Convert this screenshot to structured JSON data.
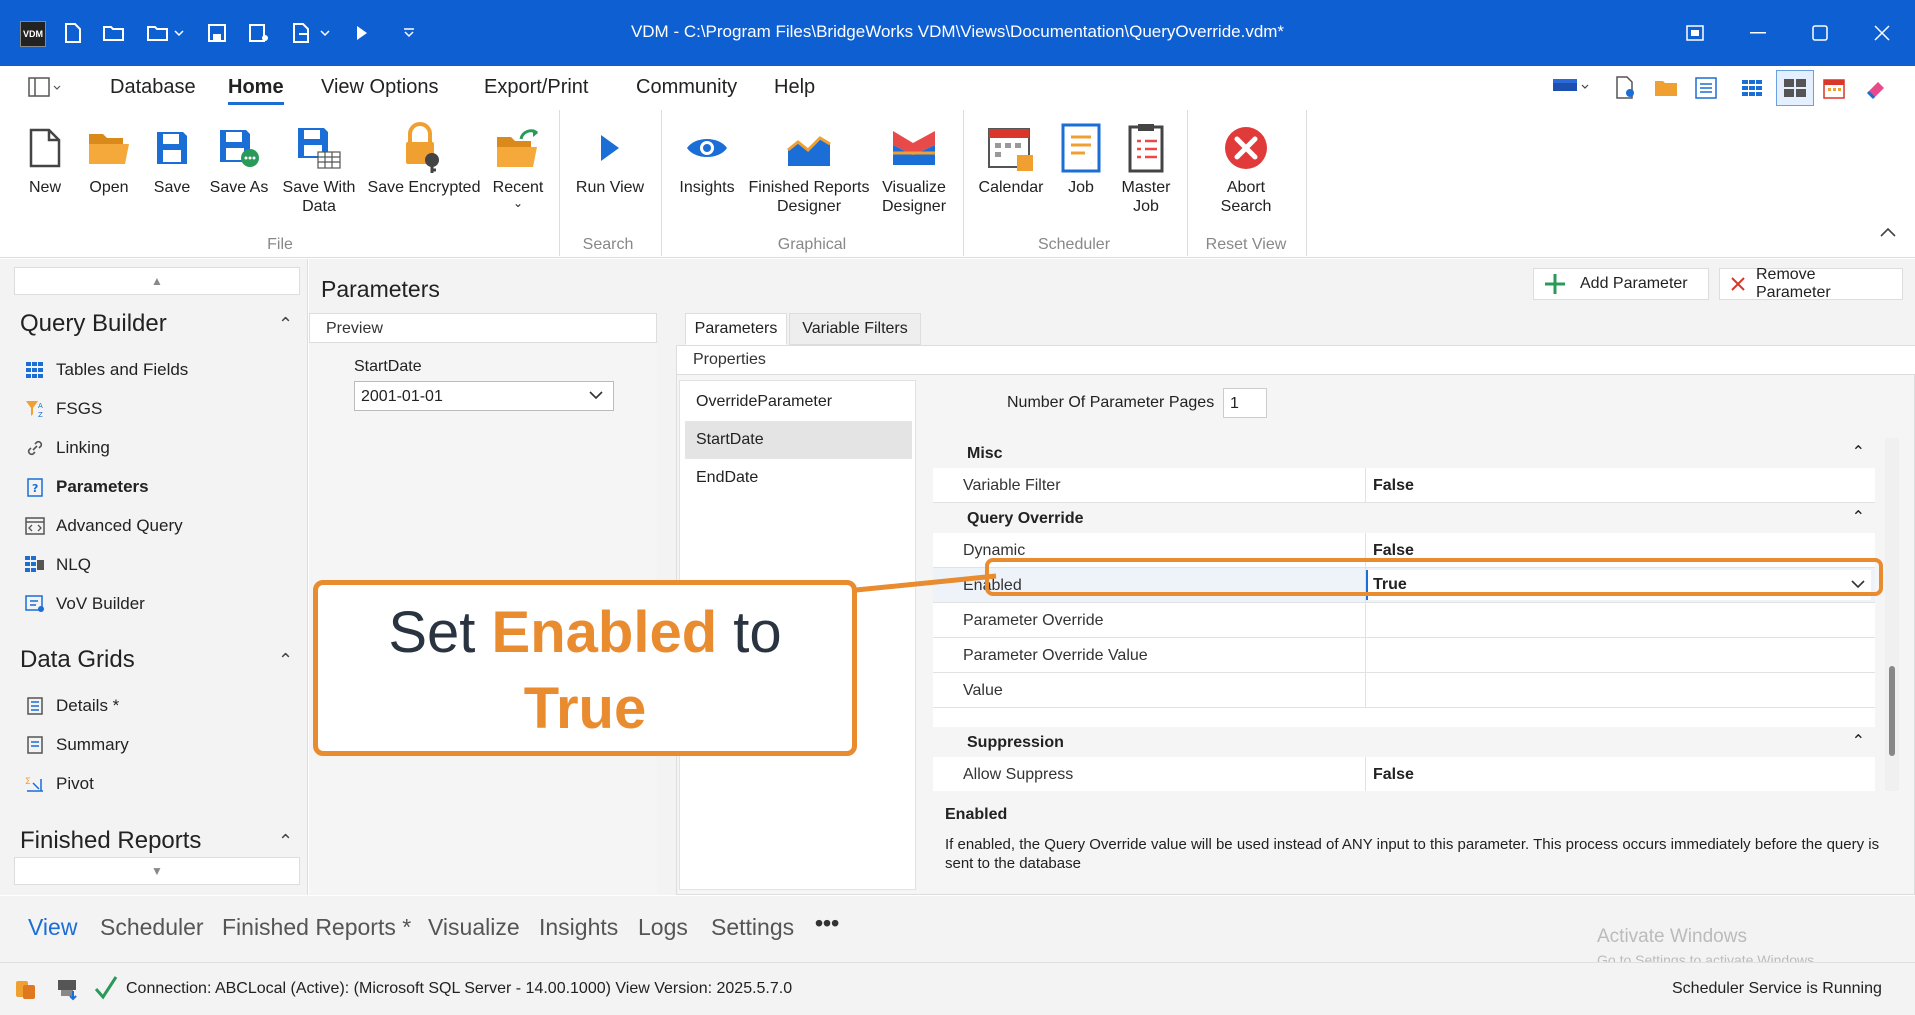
{
  "window": {
    "title": "VDM - C:\\Program Files\\BridgeWorks VDM\\Views\\Documentation\\QueryOverride.vdm*",
    "app_badge": "VDM"
  },
  "menu": {
    "items": [
      "Database",
      "Home",
      "View Options",
      "Export/Print",
      "Community",
      "Help"
    ],
    "active": "Home"
  },
  "ribbon": {
    "file": {
      "group_label": "File",
      "new": "New",
      "open": "Open",
      "save": "Save",
      "save_as": "Save As",
      "save_with_data_l1": "Save With",
      "save_with_data_l2": "Data",
      "save_encrypted": "Save Encrypted",
      "recent": "Recent"
    },
    "search": {
      "group_label": "Search",
      "run_view": "Run View"
    },
    "graphical": {
      "group_label": "Graphical",
      "insights": "Insights",
      "finished_reports_l1": "Finished Reports",
      "finished_reports_l2": "Designer",
      "visualize_l1": "Visualize",
      "visualize_l2": "Designer"
    },
    "scheduler": {
      "group_label": "Scheduler",
      "calendar": "Calendar",
      "job": "Job",
      "master_job_l1": "Master",
      "master_job_l2": "Job"
    },
    "reset_view": {
      "group_label": "Reset View",
      "abort_l1": "Abort",
      "abort_l2": "Search"
    }
  },
  "sidebar": {
    "query_builder": {
      "title": "Query Builder",
      "items": [
        "Tables and Fields",
        "FSGS",
        "Linking",
        "Parameters",
        "Advanced Query",
        "NLQ",
        "VoV Builder"
      ]
    },
    "data_grids": {
      "title": "Data Grids",
      "items": [
        "Details *",
        "Summary",
        "Pivot"
      ]
    },
    "finished_reports": {
      "title": "Finished Reports"
    }
  },
  "parameters": {
    "title": "Parameters",
    "add_button": "Add Parameter",
    "remove_button": "Remove Parameter",
    "preview": {
      "header": "Preview",
      "field_label": "StartDate",
      "field_value": "2001-01-01"
    },
    "tabs": [
      "Parameters",
      "Variable Filters"
    ],
    "properties_header": "Properties",
    "param_list": [
      "OverrideParameter",
      "StartDate",
      "EndDate"
    ],
    "selected_param": "StartDate",
    "num_pages_label": "Number Of Parameter Pages",
    "num_pages_value": "1",
    "grid": {
      "misc": "Misc",
      "variable_filter": {
        "name": "Variable Filter",
        "value": "False"
      },
      "query_override": "Query Override",
      "dynamic": {
        "name": "Dynamic",
        "value": "False"
      },
      "enabled": {
        "name": "Enabled",
        "value": "True"
      },
      "parameter_override": {
        "name": "Parameter Override",
        "value": ""
      },
      "parameter_override_value": {
        "name": "Parameter Override Value",
        "value": ""
      },
      "value": {
        "name": "Value",
        "value": ""
      },
      "suppression": "Suppression",
      "allow_suppress": {
        "name": "Allow Suppress",
        "value": "False"
      }
    },
    "description": {
      "title": "Enabled",
      "text": "If enabled, the Query Override value will be used instead of ANY input to this parameter. This process occurs immediately before the query is sent to the database"
    }
  },
  "callout": {
    "set": "Set",
    "enabled": "Enabled",
    "to": "to",
    "true": "True"
  },
  "bottom_tabs": [
    "View",
    "Scheduler",
    "Finished Reports *",
    "Visualize",
    "Insights",
    "Logs",
    "Settings",
    "•••"
  ],
  "status": {
    "connection": "Connection: ABCLocal (Active): (Microsoft SQL Server - 14.00.1000) View Version: 2025.5.7.0",
    "scheduler": "Scheduler Service is Running"
  },
  "watermark": {
    "line1": "Activate Windows",
    "line2": "Go to Settings to activate Windows."
  },
  "colors": {
    "title_bar": "#0e5fd2",
    "accent": "#1b6ed6",
    "callout": "#e98b2f"
  }
}
